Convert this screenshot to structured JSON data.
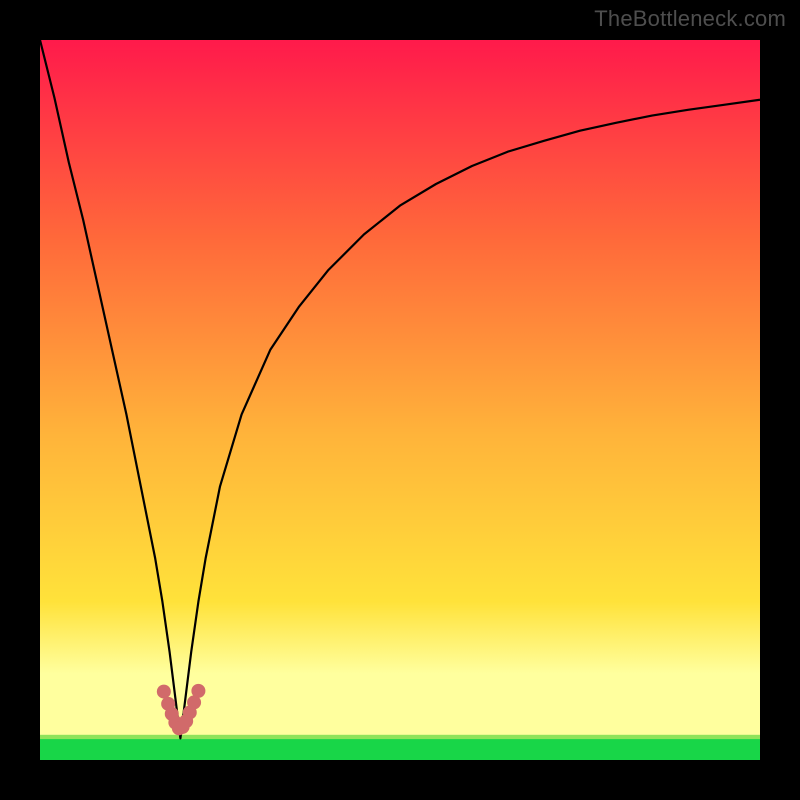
{
  "watermark": "TheBottleneck.com",
  "colors": {
    "top_gradient": "#ff1a4b",
    "mid_gradient_1": "#ff6a3a",
    "mid_gradient_2": "#ffb43a",
    "mid_gradient_3": "#ffe23a",
    "pale_band": "#ffff9e",
    "bottom_green": "#18d648",
    "curve": "#000000",
    "dots": "#d16a6a",
    "frame": "#000000"
  },
  "chart_data": {
    "type": "line",
    "title": "",
    "xlabel": "",
    "ylabel": "",
    "xlim": [
      0,
      100
    ],
    "ylim": [
      0,
      100
    ],
    "notch_x": 19.5,
    "series": [
      {
        "name": "bottleneck-curve",
        "x": [
          0,
          2,
          4,
          6,
          8,
          10,
          12,
          14,
          15,
          16,
          17,
          18,
          18.5,
          19,
          19.5,
          20,
          20.5,
          21,
          22,
          23,
          25,
          28,
          32,
          36,
          40,
          45,
          50,
          55,
          60,
          65,
          70,
          75,
          80,
          85,
          90,
          95,
          100
        ],
        "y": [
          100,
          92,
          83,
          75,
          66,
          57,
          48,
          38,
          33,
          28,
          22,
          15,
          11,
          7,
          3,
          7,
          11,
          15,
          22,
          28,
          38,
          48,
          57,
          63,
          68,
          73,
          77,
          80,
          82.5,
          84.5,
          86,
          87.4,
          88.5,
          89.5,
          90.3,
          91,
          91.7
        ]
      }
    ],
    "highlight_points": {
      "name": "near-minimum-dots",
      "x": [
        17.2,
        17.8,
        18.3,
        18.8,
        19.3,
        19.8,
        20.3,
        20.8,
        21.4,
        22.0
      ],
      "y": [
        9.5,
        7.8,
        6.4,
        5.2,
        4.4,
        4.6,
        5.4,
        6.6,
        8.0,
        9.6
      ]
    }
  }
}
